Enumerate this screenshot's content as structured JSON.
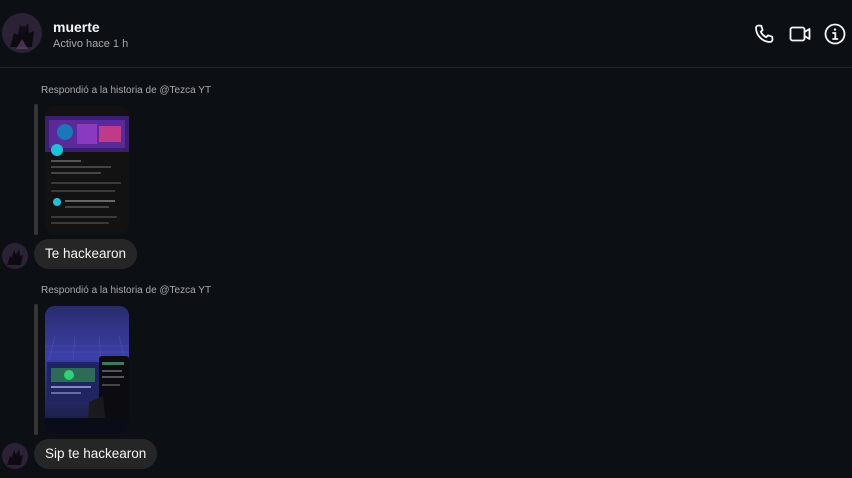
{
  "header": {
    "username": "muerte",
    "status": "Activo hace 1 h",
    "icons": [
      "phone-icon",
      "video-call-icon",
      "info-icon"
    ]
  },
  "messages": [
    {
      "reply_label": "Respondió a la historia de @Tezca YT",
      "text": "Te hackearon"
    },
    {
      "reply_label": "Respondió a la historia de @Tezca YT",
      "text": "Sip te hackearon"
    }
  ],
  "colors": {
    "background": "#0c1014",
    "bubble": "#262626",
    "secondary_text": "#a8a8a8",
    "reply_bar": "#363636"
  }
}
